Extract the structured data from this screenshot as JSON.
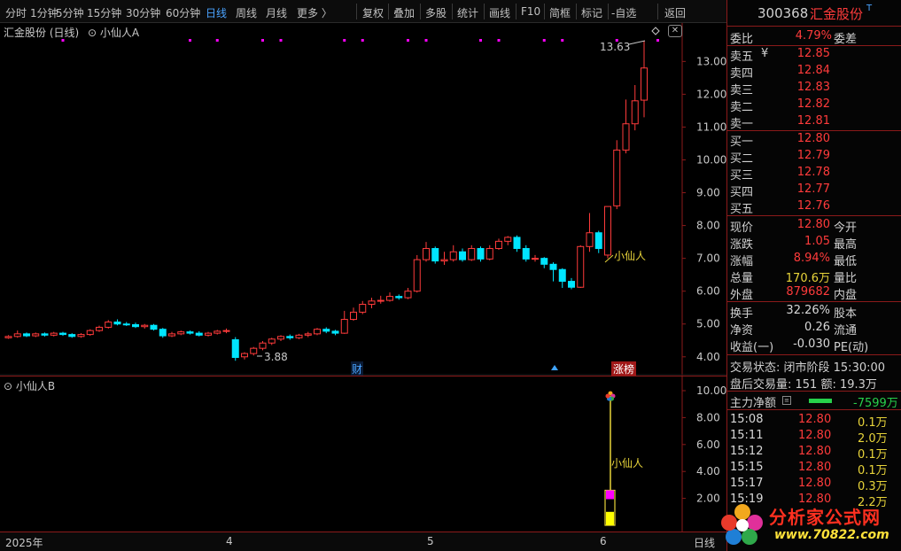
{
  "toolbar": {
    "items": [
      "分时",
      "1分钟",
      "5分钟",
      "15分钟",
      "30分钟",
      "60分钟",
      "日线",
      "周线",
      "月线",
      "更多 〉"
    ],
    "active_index": 6,
    "actions": [
      "复权",
      "叠加",
      "多股",
      "统计",
      "画线",
      "F10",
      "简框",
      "标记",
      "-自选",
      "返回"
    ]
  },
  "main_pane": {
    "stock_title": "汇金股份 (日线)",
    "indicator": "小仙人A",
    "price_axis": [
      "13.00",
      "12.00",
      "11.00",
      "10.00",
      "9.00",
      "8.00",
      "7.00",
      "6.00",
      "5.00",
      "4.00"
    ],
    "high_label": "13.63",
    "low_label": "3.88",
    "signal_label": "小仙人",
    "event_cai": "财",
    "event_zhangbang": "涨榜"
  },
  "sub_pane": {
    "indicator": "小仙人B",
    "axis": [
      "10.00",
      "8.00",
      "6.00",
      "4.00",
      "2.00"
    ],
    "signal_label": "小仙人"
  },
  "time_axis": {
    "labels": [
      "2025年",
      "4",
      "5",
      "6"
    ],
    "period": "日线"
  },
  "quote": {
    "code": "300368",
    "name": "汇金股份",
    "flag": "T",
    "weibi_label": "委比",
    "weibi": "4.79%",
    "weicha_label": "委差",
    "asks": [
      {
        "label": "卖五",
        "price": "12.85",
        "mark": "¥"
      },
      {
        "label": "卖四",
        "price": "12.84"
      },
      {
        "label": "卖三",
        "price": "12.83"
      },
      {
        "label": "卖二",
        "price": "12.82"
      },
      {
        "label": "卖一",
        "price": "12.81"
      }
    ],
    "bids": [
      {
        "label": "买一",
        "price": "12.80"
      },
      {
        "label": "买二",
        "price": "12.79"
      },
      {
        "label": "买三",
        "price": "12.78"
      },
      {
        "label": "买四",
        "price": "12.77"
      },
      {
        "label": "买五",
        "price": "12.76"
      }
    ],
    "stats": [
      {
        "l1": "现价",
        "v1": "12.80",
        "c1": "red",
        "l2": "今开"
      },
      {
        "l1": "涨跌",
        "v1": "1.05",
        "c1": "red",
        "l2": "最高"
      },
      {
        "l1": "涨幅",
        "v1": "8.94%",
        "c1": "red",
        "l2": "最低"
      },
      {
        "l1": "总量",
        "v1": "170.6万",
        "c1": "yellow",
        "l2": "量比"
      },
      {
        "l1": "外盘",
        "v1": "879682",
        "c1": "red",
        "l2": "内盘"
      }
    ],
    "stats2": [
      {
        "l1": "换手",
        "v1": "32.26%",
        "l2": "股本"
      },
      {
        "l1": "净资",
        "v1": "0.26",
        "l2": "流通"
      },
      {
        "l1": "收益(一)",
        "v1": "-0.030",
        "l2": "PE(动)"
      }
    ],
    "trade_status": "交易状态: 闭市阶段 15:30:00",
    "after_volume": "盘后交易量: 151  额: 19.3万",
    "main_net_label": "主力净额",
    "main_net_value": "-7599万",
    "ticks": [
      {
        "time": "15:08",
        "price": "12.80",
        "vol": "0.1万"
      },
      {
        "time": "15:11",
        "price": "12.80",
        "vol": "2.0万"
      },
      {
        "time": "15:12",
        "price": "12.80",
        "vol": "0.1万"
      },
      {
        "time": "15:15",
        "price": "12.80",
        "vol": "0.1万"
      },
      {
        "time": "15:17",
        "price": "12.80",
        "vol": "0.3万"
      },
      {
        "time": "15:19",
        "price": "12.80",
        "vol": "2.2万"
      }
    ]
  },
  "watermark": {
    "title": "分析家公式网",
    "url": "www.70822.com"
  },
  "colors": {
    "up": "#ff3b3b",
    "down": "#00e5ff",
    "border": "#8b1a1a",
    "signal": "#e8d43a",
    "magenta": "#ff00ff"
  },
  "candles": [
    [
      4.58,
      4.62,
      4.55,
      4.66
    ],
    [
      4.62,
      4.7,
      4.58,
      4.8
    ],
    [
      4.7,
      4.64,
      4.6,
      4.74
    ],
    [
      4.64,
      4.7,
      4.6,
      4.74
    ],
    [
      4.7,
      4.66,
      4.62,
      4.74
    ],
    [
      4.66,
      4.72,
      4.62,
      4.76
    ],
    [
      4.72,
      4.68,
      4.64,
      4.76
    ],
    [
      4.68,
      4.62,
      4.58,
      4.72
    ],
    [
      4.62,
      4.68,
      4.58,
      4.72
    ],
    [
      4.68,
      4.8,
      4.64,
      4.84
    ],
    [
      4.8,
      4.9,
      4.76,
      4.95
    ],
    [
      4.9,
      5.06,
      4.86,
      5.12
    ],
    [
      5.06,
      5.0,
      4.96,
      5.14
    ],
    [
      5.0,
      4.98,
      4.94,
      5.06
    ],
    [
      4.98,
      4.92,
      4.88,
      5.04
    ],
    [
      4.92,
      4.96,
      4.86,
      5.0
    ],
    [
      4.96,
      4.84,
      4.8,
      5.0
    ],
    [
      4.84,
      4.64,
      4.58,
      4.88
    ],
    [
      4.64,
      4.7,
      4.6,
      4.76
    ],
    [
      4.7,
      4.76,
      4.66,
      4.8
    ],
    [
      4.76,
      4.72,
      4.68,
      4.8
    ],
    [
      4.72,
      4.66,
      4.62,
      4.78
    ],
    [
      4.66,
      4.72,
      4.62,
      4.76
    ],
    [
      4.72,
      4.78,
      4.68,
      4.82
    ],
    [
      4.78,
      4.8,
      4.72,
      4.86
    ],
    [
      4.52,
      3.98,
      3.88,
      4.6
    ],
    [
      4.0,
      4.1,
      3.92,
      4.14
    ],
    [
      4.1,
      4.26,
      4.04,
      4.3
    ],
    [
      4.26,
      4.42,
      4.2,
      4.48
    ],
    [
      4.42,
      4.54,
      4.36,
      4.58
    ],
    [
      4.54,
      4.62,
      4.48,
      4.66
    ],
    [
      4.62,
      4.58,
      4.52,
      4.68
    ],
    [
      4.58,
      4.66,
      4.54,
      4.7
    ],
    [
      4.66,
      4.7,
      4.6,
      4.76
    ],
    [
      4.7,
      4.84,
      4.66,
      4.88
    ],
    [
      4.84,
      4.78,
      4.72,
      4.9
    ],
    [
      4.78,
      4.72,
      4.66,
      4.82
    ],
    [
      4.72,
      5.14,
      4.7,
      5.4
    ],
    [
      5.14,
      5.36,
      5.1,
      5.5
    ],
    [
      5.36,
      5.6,
      5.3,
      5.7
    ],
    [
      5.6,
      5.7,
      5.48,
      5.8
    ],
    [
      5.7,
      5.72,
      5.62,
      5.86
    ],
    [
      5.72,
      5.84,
      5.68,
      5.96
    ],
    [
      5.84,
      5.8,
      5.74,
      5.9
    ],
    [
      5.8,
      6.0,
      5.76,
      6.1
    ],
    [
      6.0,
      6.96,
      5.96,
      7.1
    ],
    [
      6.96,
      7.3,
      6.9,
      7.5
    ],
    [
      7.3,
      6.92,
      6.84,
      7.36
    ],
    [
      6.92,
      6.96,
      6.8,
      7.2
    ],
    [
      6.96,
      7.2,
      6.9,
      7.4
    ],
    [
      7.2,
      6.96,
      6.9,
      7.3
    ],
    [
      6.96,
      7.3,
      6.92,
      7.4
    ],
    [
      7.3,
      6.98,
      6.9,
      7.36
    ],
    [
      6.98,
      7.3,
      6.94,
      7.4
    ],
    [
      7.3,
      7.52,
      7.26,
      7.6
    ],
    [
      7.52,
      7.64,
      7.4,
      7.68
    ],
    [
      7.64,
      7.3,
      7.2,
      7.7
    ],
    [
      7.3,
      6.98,
      6.9,
      7.4
    ],
    [
      6.98,
      7.0,
      6.9,
      7.1
    ],
    [
      7.0,
      6.82,
      6.7,
      7.04
    ],
    [
      6.82,
      6.66,
      6.3,
      6.88
    ],
    [
      6.66,
      6.3,
      6.1,
      6.7
    ],
    [
      6.3,
      6.12,
      6.06,
      6.4
    ],
    [
      6.12,
      7.36,
      6.1,
      7.4
    ],
    [
      7.36,
      7.78,
      7.2,
      8.38
    ],
    [
      7.78,
      7.3,
      7.16,
      7.84
    ],
    [
      7.1,
      8.58,
      7.0,
      8.58
    ],
    [
      8.6,
      10.3,
      8.5,
      10.6
    ],
    [
      10.3,
      11.1,
      10.2,
      11.84
    ],
    [
      11.1,
      11.8,
      10.9,
      12.28
    ],
    [
      11.82,
      12.8,
      11.3,
      13.63
    ]
  ]
}
